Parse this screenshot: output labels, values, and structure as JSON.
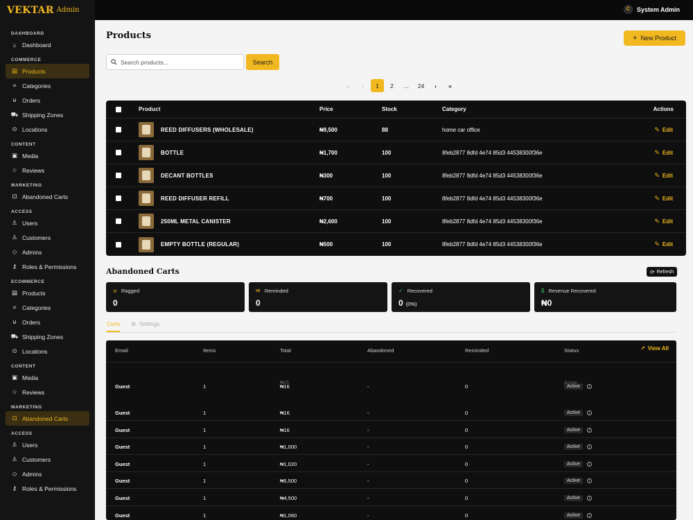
{
  "brand": {
    "name": "VEKTAR",
    "sub": "Admin"
  },
  "topbar": {
    "user": "System Admin",
    "avatar": "C"
  },
  "sidebar": [
    {
      "section": "DASHBOARD",
      "items": [
        {
          "label": "Dashboard",
          "icon": "home-icon",
          "glyph": "⌂"
        }
      ]
    },
    {
      "section": "COMMERCE",
      "items": [
        {
          "label": "Products",
          "icon": "box-icon",
          "glyph": "▤",
          "active": true
        },
        {
          "label": "Categories",
          "icon": "tag-icon",
          "glyph": "⌗"
        },
        {
          "label": "Orders",
          "icon": "cart-icon",
          "glyph": "⊍"
        },
        {
          "label": "Shipping Zones",
          "icon": "truck-icon",
          "glyph": "⛟"
        },
        {
          "label": "Locations",
          "icon": "pin-icon",
          "glyph": "⊙"
        }
      ]
    },
    {
      "section": "CONTENT",
      "items": [
        {
          "label": "Media",
          "icon": "image-icon",
          "glyph": "▣"
        },
        {
          "label": "Reviews",
          "icon": "star-icon",
          "glyph": "☆"
        }
      ]
    },
    {
      "section": "MARKETING",
      "items": [
        {
          "label": "Abandoned Carts",
          "icon": "bag-icon",
          "glyph": "⊡"
        }
      ]
    },
    {
      "section": "ACCESS",
      "items": [
        {
          "label": "Users",
          "icon": "user-icon",
          "glyph": "♙"
        },
        {
          "label": "Customers",
          "icon": "users-icon",
          "glyph": "♙"
        },
        {
          "label": "Admins",
          "icon": "shield-icon",
          "glyph": "◇"
        },
        {
          "label": "Roles & Permissions",
          "icon": "key-icon",
          "glyph": "⚷"
        }
      ]
    },
    {
      "section": "ECOMMERCE",
      "items": [
        {
          "label": "Products",
          "icon": "box-icon",
          "glyph": "▤"
        },
        {
          "label": "Categories",
          "icon": "tag-icon",
          "glyph": "⌗"
        },
        {
          "label": "Orders",
          "icon": "cart-icon",
          "glyph": "⊍"
        },
        {
          "label": "Shipping Zones",
          "icon": "truck-icon",
          "glyph": "⛟"
        },
        {
          "label": "Locations",
          "icon": "pin-icon",
          "glyph": "⊙"
        }
      ]
    },
    {
      "section": "CONTENT",
      "items": [
        {
          "label": "Media",
          "icon": "image-icon",
          "glyph": "▣"
        },
        {
          "label": "Reviews",
          "icon": "star-icon",
          "glyph": "☆"
        }
      ]
    },
    {
      "section": "MARKETING",
      "items": [
        {
          "label": "Abandoned Carts",
          "icon": "bag-icon",
          "glyph": "⊡",
          "active": true
        }
      ]
    },
    {
      "section": "ACCESS",
      "items": [
        {
          "label": "Users",
          "icon": "user-icon",
          "glyph": "♙"
        },
        {
          "label": "Customers",
          "icon": "users-icon",
          "glyph": "♙"
        },
        {
          "label": "Admins",
          "icon": "shield-icon",
          "glyph": "◇"
        },
        {
          "label": "Roles & Permissions",
          "icon": "key-icon",
          "glyph": "⚷"
        }
      ]
    }
  ],
  "products": {
    "title": "Products",
    "new_button": "New Product",
    "search_placeholder": "Search products...",
    "search_button": "Search",
    "pagination": [
      "«",
      "‹",
      "1",
      "2",
      "...",
      "24",
      "›",
      "»"
    ],
    "current_page": "1",
    "columns": {
      "product": "Product",
      "price": "Price",
      "stock": "Stock",
      "category": "Category",
      "actions": "Actions"
    },
    "edit_label": "Edit",
    "rows": [
      {
        "name": "REED DIFFUSERS (WHOLESALE)",
        "price": "₦9,500",
        "stock": "88",
        "category": "home car office"
      },
      {
        "name": "BOTTLE",
        "price": "₦1,700",
        "stock": "100",
        "category": "8feb2877 8dfd 4e74 85d3 44538300f36e"
      },
      {
        "name": "DECANT BOTTLES",
        "price": "₦300",
        "stock": "100",
        "category": "8feb2877 8dfd 4e74 85d3 44538300f36e"
      },
      {
        "name": "REED DIFFUSER REFILL",
        "price": "₦700",
        "stock": "100",
        "category": "8feb2877 8dfd 4e74 85d3 44538300f36e"
      },
      {
        "name": "250ML METAL CANISTER",
        "price": "₦2,600",
        "stock": "100",
        "category": "8feb2877 8dfd 4e74 85d3 44538300f36e"
      },
      {
        "name": "EMPTY BOTTLE (REGULAR)",
        "price": "₦500",
        "stock": "100",
        "category": "8feb2877 8dfd 4e74 85d3 44538300f36e"
      }
    ]
  },
  "carts": {
    "title": "Abandoned Carts",
    "refresh": "Refresh",
    "stats": [
      {
        "label": "Ragged",
        "value": "0",
        "icon": "cart-icon",
        "glyph": "⊍"
      },
      {
        "label": "Reminded",
        "value": "0",
        "icon": "mail-icon",
        "glyph": "✉"
      },
      {
        "label": "Recovered",
        "value": "0",
        "extra": "(0%)",
        "icon": "check-icon",
        "glyph": "✓"
      },
      {
        "label": "Revenue Recovered",
        "value": "₦0",
        "icon": "dollar-icon",
        "glyph": "$"
      }
    ],
    "tabs": [
      "Carts",
      "Settings"
    ],
    "view_all": "View All",
    "columns": [
      "Email",
      "Items",
      "Total",
      "Abandoned",
      "Reminded",
      "Status"
    ],
    "ghost_total": "₦26",
    "ghost_status": "Active",
    "rows": [
      {
        "email": "Guest",
        "items": "1",
        "total": "₦16",
        "abandoned": "-",
        "reminded": "0",
        "status": "Active"
      },
      {
        "email": "Guest",
        "items": "1",
        "total": "₦16",
        "abandoned": "-",
        "reminded": "0",
        "status": "Active"
      },
      {
        "email": "Guest",
        "items": "1",
        "total": "₦16",
        "abandoned": "-",
        "reminded": "0",
        "status": "Active"
      },
      {
        "email": "Guest",
        "items": "1",
        "total": "₦1,000",
        "abandoned": "-",
        "reminded": "0",
        "status": "Active"
      },
      {
        "email": "Guest",
        "items": "1",
        "total": "₦1,020",
        "abandoned": "-",
        "reminded": "0",
        "status": "Active"
      },
      {
        "email": "Guest",
        "items": "1",
        "total": "₦5,500",
        "abandoned": "-",
        "reminded": "0",
        "status": "Active"
      },
      {
        "email": "Guest",
        "items": "1",
        "total": "₦4,500",
        "abandoned": "-",
        "reminded": "0",
        "status": "Active"
      },
      {
        "email": "Guest",
        "items": "1",
        "total": "₦1,060",
        "abandoned": "-",
        "reminded": "0",
        "status": "Active"
      }
    ]
  },
  "colors": {
    "accent": "#f2b81f",
    "sidebar": "#141414",
    "table": "#0f0f0f"
  }
}
